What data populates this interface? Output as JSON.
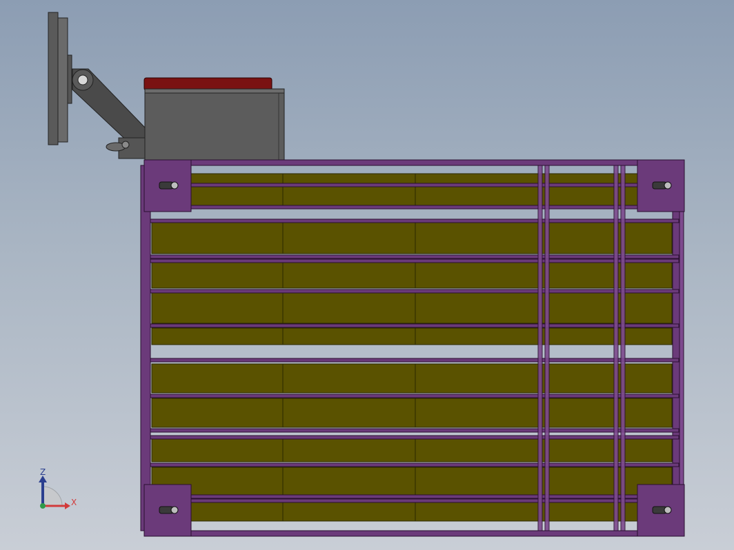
{
  "view": {
    "title": "",
    "colors": {
      "background_top": "#8c9db3",
      "background_bottom": "#c9ced6",
      "frame": "#6b3a7a",
      "frame_light": "#7d4a8e",
      "panel": "#5a5200",
      "panel_line": "#2a2800",
      "housing": "#5c5c5c",
      "housing_top": "#7a1212",
      "arm": "#4a4a4a"
    }
  },
  "triad": {
    "z_label": "Z",
    "x_label": "X",
    "z_color": "#2b3f8f",
    "x_color": "#d23a3a"
  },
  "model": {
    "panel_rows": 8,
    "panel_columns": 4,
    "casters": 4
  }
}
